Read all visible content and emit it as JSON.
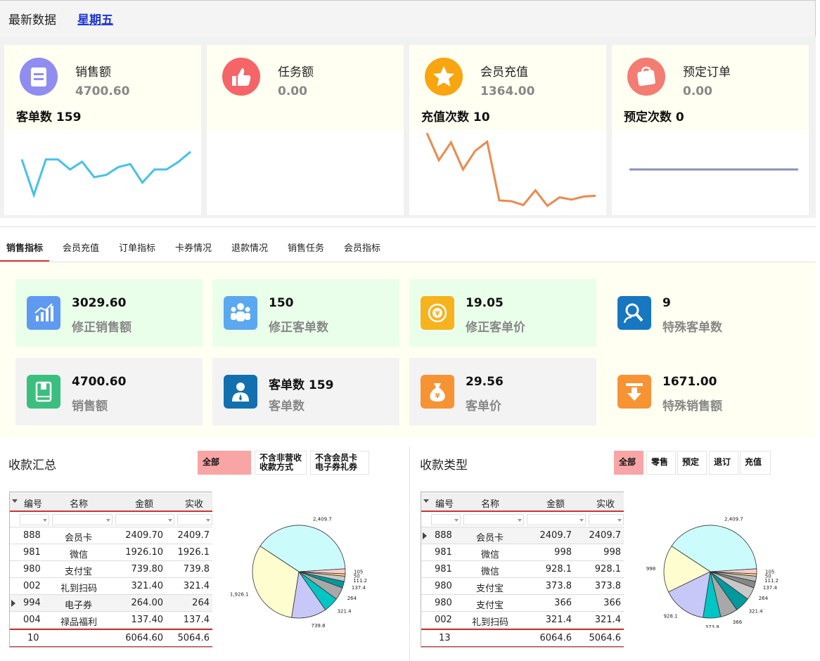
{
  "header": {
    "title": "最新数据",
    "weekday": "星期五"
  },
  "cards": [
    {
      "label": "销售额",
      "value": "4700.60",
      "sub": "客单数 159",
      "icon": "document-icon",
      "color": "#8f8ef0",
      "spark_color": "#47c0ea",
      "spark": [
        0.63,
        0.17,
        0.63,
        0.63,
        0.5,
        0.6,
        0.4,
        0.43,
        0.53,
        0.57,
        0.33,
        0.5,
        0.5,
        0.6,
        0.73
      ]
    },
    {
      "label": "任务额",
      "value": "0.00",
      "sub": "",
      "icon": "thumbs-up-icon",
      "color": "#f56467",
      "spark_color": "",
      "spark": []
    },
    {
      "label": "会员充值",
      "value": "1364.00",
      "sub": "充值次数 10",
      "icon": "star-icon",
      "color": "#f9a50f",
      "spark_color": "#ea8a4f",
      "spark": [
        0.97,
        0.62,
        0.85,
        0.5,
        0.74,
        0.86,
        0.1,
        0.09,
        0.04,
        0.23,
        0.03,
        0.14,
        0.11,
        0.15,
        0.16
      ]
    },
    {
      "label": "预定订单",
      "value": "0.00",
      "sub": "预定次数 0",
      "icon": "shopping-bag-icon",
      "color": "#f37d73",
      "spark_color": "#8891bd",
      "spark": [
        0.5,
        0.5,
        0.5,
        0.5,
        0.5,
        0.5,
        0.5,
        0.5,
        0.5,
        0.5
      ]
    }
  ],
  "tabs": [
    "销售指标",
    "会员充值",
    "订单指标",
    "卡券情况",
    "退款情况",
    "销售任务",
    "会员指标"
  ],
  "metrics": [
    {
      "value": "3029.60",
      "label": "修正销售额",
      "icon": "bar-chart-icon",
      "color": "#5f9af0",
      "bg": "#eaffea"
    },
    {
      "value": "150",
      "label": "修正客单数",
      "icon": "users-icon",
      "color": "#5aa8f0",
      "bg": "#eaffea"
    },
    {
      "value": "19.05",
      "label": "修正客单价",
      "icon": "yen-refresh-icon",
      "color": "#f6b31e",
      "bg": "#eaffea"
    },
    {
      "value": "9",
      "label": "特殊客单数",
      "icon": "user-search-icon",
      "color": "#1777c0",
      "bg": "#fffff2"
    },
    {
      "value": "4700.60",
      "label": "销售额",
      "icon": "book-icon",
      "color": "#3bbf7e",
      "bg": "#f3f3f3"
    },
    {
      "value": "客单数 159",
      "label": "客单数",
      "icon": "user-icon",
      "color": "#1270ae",
      "bg": "#f3f3f3"
    },
    {
      "value": "29.56",
      "label": "客单价",
      "icon": "money-bag-icon",
      "color": "#f79333",
      "bg": "#f3f3f3"
    },
    {
      "value": "1671.00",
      "label": "特殊销售额",
      "icon": "download-icon",
      "color": "#f79333",
      "bg": "#fffff2"
    }
  ],
  "summary": {
    "title": "收款汇总",
    "filters": [
      "全部",
      "不含非营收 收款方式",
      "不含会员卡 电子券礼券"
    ],
    "columns": [
      "编号",
      "名称",
      "金额",
      "实收"
    ],
    "rows": [
      [
        "888",
        "会员卡",
        "2409.70",
        "2409.7"
      ],
      [
        "981",
        "微信",
        "1926.10",
        "1926.1"
      ],
      [
        "980",
        "支付宝",
        "739.80",
        "739.8"
      ],
      [
        "002",
        "礼到扫码",
        "321.40",
        "321.4"
      ],
      [
        "994",
        "电子券",
        "264.00",
        "264"
      ],
      [
        "004",
        "禄品福利",
        "137.40",
        "137.4"
      ]
    ],
    "footer": [
      "10",
      "",
      "6064.60",
      "5064.6"
    ],
    "selected_row": 4
  },
  "types": {
    "title": "收款类型",
    "filters": [
      "全部",
      "零售",
      "预定",
      "退订",
      "充值"
    ],
    "columns": [
      "编号",
      "名称",
      "金额",
      "实收"
    ],
    "rows": [
      [
        "888",
        "会员卡",
        "2409.7",
        "2409.7"
      ],
      [
        "981",
        "微信",
        "998",
        "998"
      ],
      [
        "981",
        "微信",
        "928.1",
        "928.1"
      ],
      [
        "980",
        "支付宝",
        "373.8",
        "373.8"
      ],
      [
        "980",
        "支付宝",
        "366",
        "366"
      ],
      [
        "002",
        "礼到扫码",
        "321.4",
        "321.4"
      ]
    ],
    "footer": [
      "13",
      "",
      "6064.6",
      "5064.6"
    ],
    "selected_row": 0
  },
  "chart_data": [
    {
      "type": "pie",
      "values": [
        2409.7,
        1926.1,
        739.8,
        321.4,
        264,
        137.4,
        111.2,
        50,
        105
      ],
      "labels": [
        "2,409.7",
        "1,926.1",
        "739.8",
        "321.4",
        "264",
        "137.4",
        "111.2",
        "50",
        "105"
      ],
      "colors": [
        "#ccfbfb",
        "#fdfdcf",
        "#c8c8f8",
        "#00c5c5",
        "#a8a8a8",
        "#00999d",
        "#c8c8c8",
        "#ffd680",
        "#fecbd3"
      ]
    },
    {
      "type": "pie",
      "values": [
        2409.7,
        998,
        928.1,
        373.8,
        366,
        321.4,
        264,
        137.4,
        111.2,
        50,
        105
      ],
      "labels": [
        "2,409.7",
        "998",
        "928.1",
        "373.8",
        "366",
        "321.4",
        "264",
        "137.4",
        "111.2",
        "50",
        "105"
      ],
      "colors": [
        "#ccfbfb",
        "#fdfdcf",
        "#c8c8f8",
        "#00c5c5",
        "#a8a8a8",
        "#00999d",
        "#c8c8c8",
        "#888888",
        "#bebebe",
        "#ffd680",
        "#fecbd3"
      ]
    }
  ]
}
